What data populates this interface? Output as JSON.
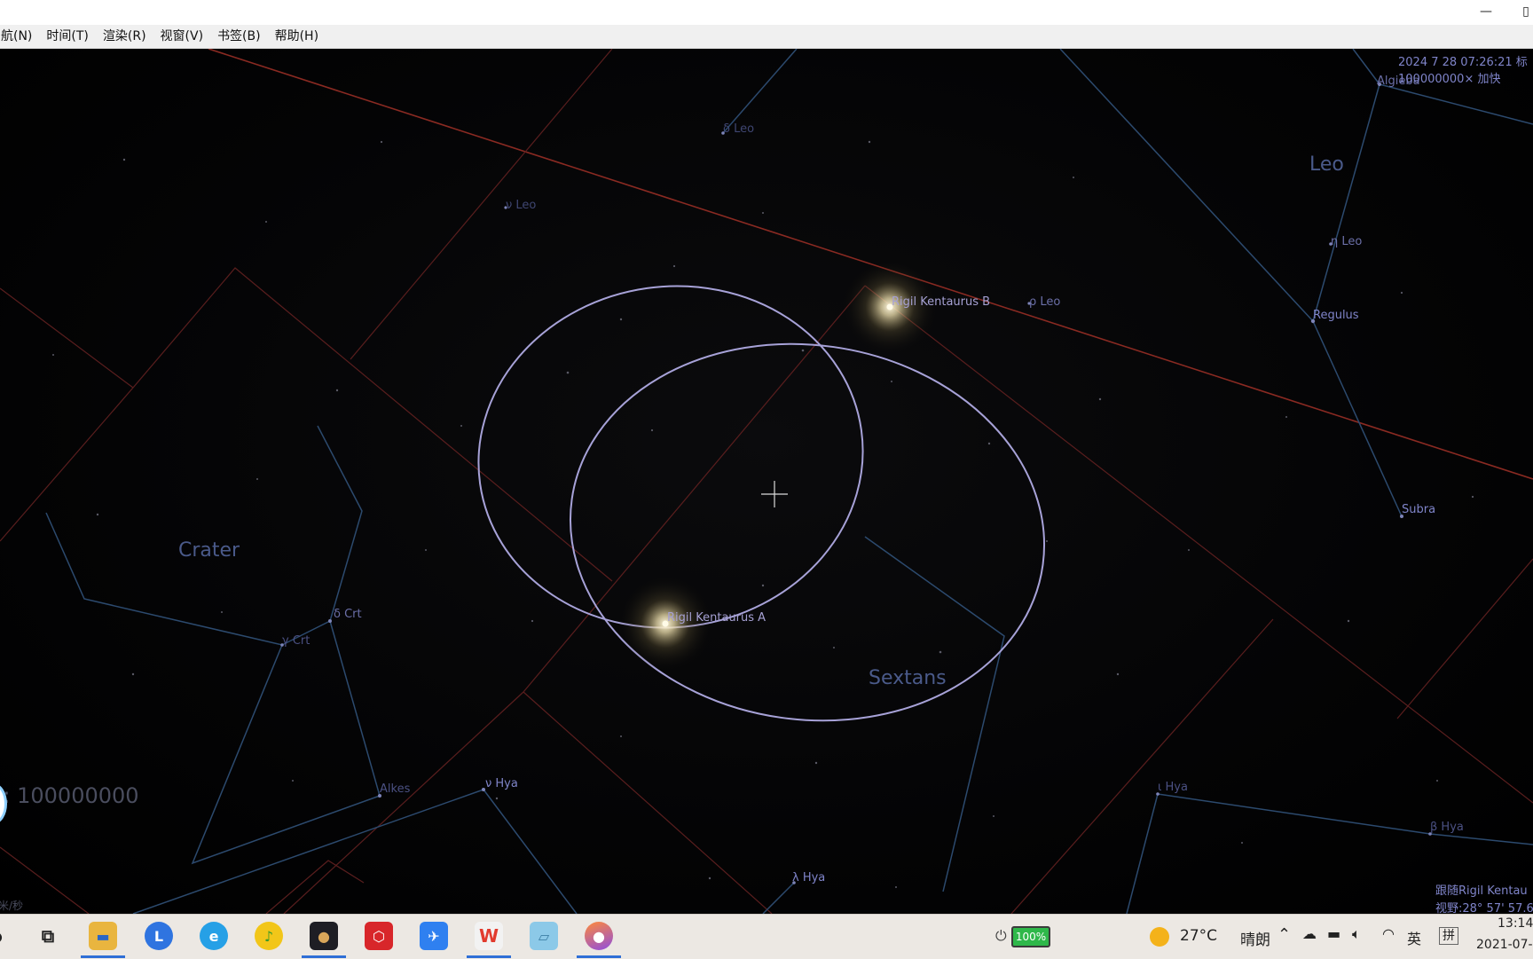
{
  "window": {
    "minimize_glyph": "—",
    "maximize_glyph": "▯"
  },
  "menu": {
    "items": [
      {
        "label": "航(N)"
      },
      {
        "label": "时间(T)"
      },
      {
        "label": "渲染(R)"
      },
      {
        "label": "视窗(V)"
      },
      {
        "label": "书签(B)"
      },
      {
        "label": "帮助(H)"
      }
    ]
  },
  "hud": {
    "datetime": "2024 7 28 07:26:21 标",
    "time_rate": "100000000× 加快",
    "speed_large": "t: 100000000",
    "speed_unit": "米/秒",
    "follow_target": "跟随Rigil Kentau",
    "field_of_view": "视野:28° 57' 57.6"
  },
  "sky": {
    "constellations": [
      {
        "name": "Leo"
      },
      {
        "name": "Crater"
      },
      {
        "name": "Sextans"
      }
    ],
    "stars": [
      {
        "label": "Rigil Kentaurus B"
      },
      {
        "label": "Rigil Kentaurus A"
      },
      {
        "label": "ρ Leo"
      },
      {
        "label": "η Leo"
      },
      {
        "label": "Regulus"
      },
      {
        "label": "Subra"
      },
      {
        "label": "Algieba"
      },
      {
        "label": "δ Leo"
      },
      {
        "label": "ν Leo"
      },
      {
        "label": "δ Crt"
      },
      {
        "label": "γ Crt"
      },
      {
        "label": "Alkes"
      },
      {
        "label": "ν Hya"
      },
      {
        "label": "λ Hya"
      },
      {
        "label": "ι Hya"
      },
      {
        "label": "β Hya"
      }
    ]
  },
  "taskbar": {
    "apps": [
      {
        "name": "task-view",
        "glyph": "⧉"
      },
      {
        "name": "file-explorer",
        "glyph": "▬"
      },
      {
        "name": "l-app",
        "glyph": "L"
      },
      {
        "name": "browser",
        "glyph": "e"
      },
      {
        "name": "music",
        "glyph": "♪"
      },
      {
        "name": "celestia",
        "glyph": "●"
      },
      {
        "name": "red-app",
        "glyph": "⬡"
      },
      {
        "name": "feishu",
        "glyph": "✈"
      },
      {
        "name": "wps",
        "glyph": "W"
      },
      {
        "name": "notes",
        "glyph": "▱"
      },
      {
        "name": "drop-app",
        "glyph": "●"
      }
    ],
    "battery": "100%",
    "weather_temp": "27°C",
    "weather_desc": "晴朗",
    "ime_lang": "英",
    "ime_mode": "拼",
    "clock_time": "13:14",
    "clock_date": "2021-07-"
  }
}
